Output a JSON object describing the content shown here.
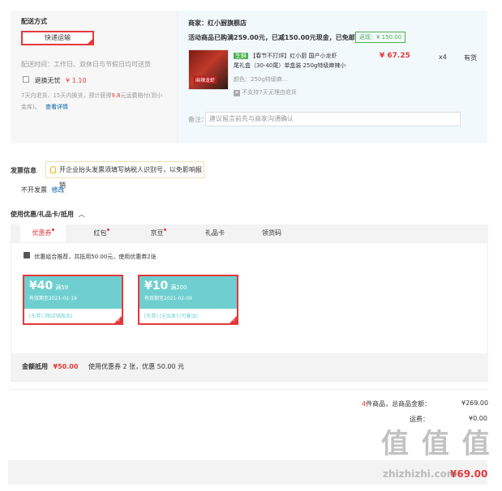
{
  "shipping": {
    "title": "配送方式",
    "method_button": "快递运输",
    "time_text": "配送时间：工作日、双休日与节假日均可送货",
    "insurance_label": "退换无忧",
    "insurance_price": "¥ 1.10",
    "insurance_desc_1": "7天内退货、15天内换货，预计获得",
    "insurance_desc_red": "9.8",
    "insurance_desc_2": "元运费赔付(到小",
    "insurance_desc_3": "金库)。",
    "details_link": "查看详情"
  },
  "shop": {
    "seller_label": "商家：",
    "seller_name": "红小厨旗舰店",
    "promo_text": "活动商品已购满259.00元，已减150.00元现金，已免邮",
    "reach_text": "返现：¥ 150.00",
    "fresh_tag": "生鲜",
    "product_name_1": "【春节不打烊】红小厨 国产小龙虾",
    "product_name_2": "尾礼盒（30-40尾）单盒装 250g特级麻辣小",
    "product_image_label": "麻辣龙虾",
    "price": "¥ 67.25",
    "quantity": "x4",
    "stock": "有货",
    "spec": "颜色：250g特级麻...",
    "return_policy": "不支持7天无理由退货",
    "remark_label": "备注：",
    "remark_placeholder": "建议留言前先与商家沟通确认"
  },
  "invoice": {
    "title": "发票信息",
    "tip": "开企业抬头发票须填写纳税人识别号，以免影响报销",
    "value": "不开发票",
    "edit_link": "修改"
  },
  "coupons": {
    "title": "使用优惠/礼品卡/抵用",
    "tabs": [
      {
        "label": "优惠券",
        "dot": true
      },
      {
        "label": "红包",
        "dot": true
      },
      {
        "label": "京豆",
        "dot": true
      },
      {
        "label": "礼品卡",
        "dot": false
      },
      {
        "label": "领货码",
        "dot": false
      }
    ],
    "combo_text": "优惠组合推荐，共抵用50.00元，使用优惠券2张",
    "items": [
      {
        "amount": "¥40",
        "condition": "满59",
        "date": "有效期至2021-02-19",
        "tags": "[东券]  [限店铺商品]"
      },
      {
        "amount": "¥10",
        "condition": "满200",
        "date": "有效期至2021-02-09",
        "tags": "[东券]  [全品类]  [可叠加]"
      }
    ],
    "deduct_label": "金额抵用",
    "deduct_amount": "¥50.00",
    "deduct_desc": "使用优惠券 2 张，优惠 50.00 元"
  },
  "totals": {
    "count_prefix": "4",
    "count_label": "件商品，总商品金额：",
    "goods_total": "¥269.00",
    "freight_label": "运费：",
    "freight_value": "¥0.00",
    "pay_value": "¥69.00"
  },
  "watermark": {
    "glyphs": "值 值 值",
    "site": "zhizhizhi.com"
  }
}
